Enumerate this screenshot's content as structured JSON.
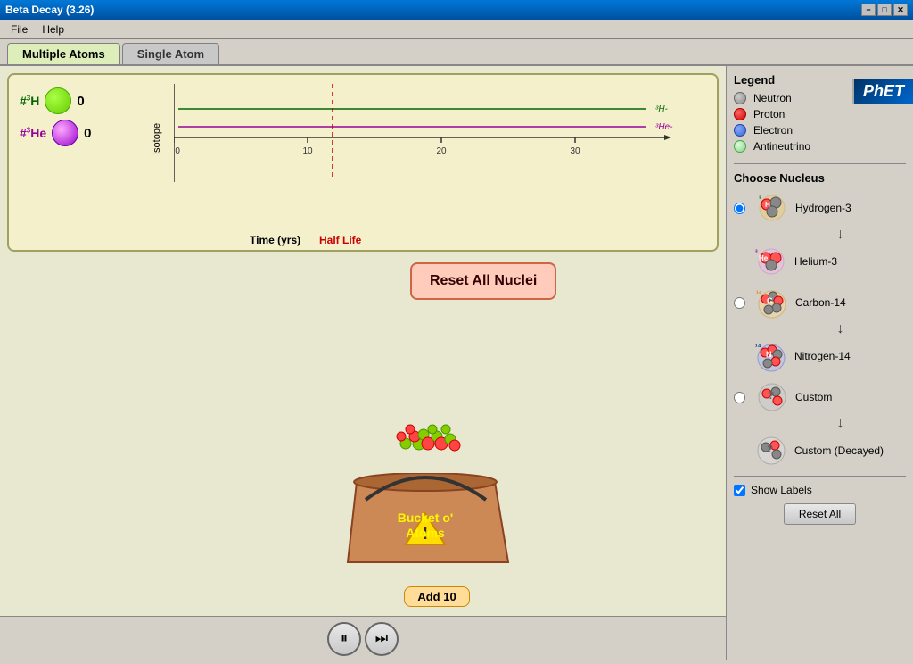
{
  "titleBar": {
    "title": "Beta Decay (3.26)",
    "minimizeBtn": "−",
    "restoreBtn": "□",
    "closeBtn": "✕"
  },
  "menuBar": {
    "items": [
      "File",
      "Help"
    ]
  },
  "tabs": [
    {
      "label": "Multiple Atoms",
      "active": true
    },
    {
      "label": "Single Atom",
      "active": false
    }
  ],
  "phet": {
    "logo": "PhET"
  },
  "chart": {
    "hydrogenLabel": "#³H",
    "heliumLabel": "#³He",
    "hydrogenCount": "0",
    "heliumCount": "0",
    "isotopeAxisLabel": "Isotope",
    "timeAxisLabel": "Time (yrs)",
    "halfLifeLabel": "Half Life",
    "xLabels": [
      "0.0",
      "10",
      "20",
      "30"
    ]
  },
  "buttons": {
    "resetNuclei": "Reset All Nuclei",
    "addTen": "Add 10",
    "resetAll": "Reset All"
  },
  "bucket": {
    "line1": "Bucket o'",
    "line2": "Atoms"
  },
  "legend": {
    "title": "Legend",
    "items": [
      {
        "label": "Neutron",
        "type": "neutron"
      },
      {
        "label": "Proton",
        "type": "proton"
      },
      {
        "label": "Electron",
        "type": "electron"
      },
      {
        "label": "Antineutrino",
        "type": "antineutrino"
      }
    ]
  },
  "chooseNucleus": {
    "title": "Choose Nucleus",
    "options": [
      {
        "label": "Hydrogen-3",
        "decaysTo": "Helium-3",
        "selected": true
      },
      {
        "label": "Carbon-14",
        "decaysTo": "Nitrogen-14",
        "selected": false
      },
      {
        "label": "Custom",
        "decaysTo": "Custom (Decayed)",
        "selected": false
      }
    ]
  },
  "showLabels": {
    "label": "Show Labels",
    "checked": true
  },
  "playback": {
    "pauseSymbol": "⏸",
    "stepSymbol": "⏭"
  }
}
